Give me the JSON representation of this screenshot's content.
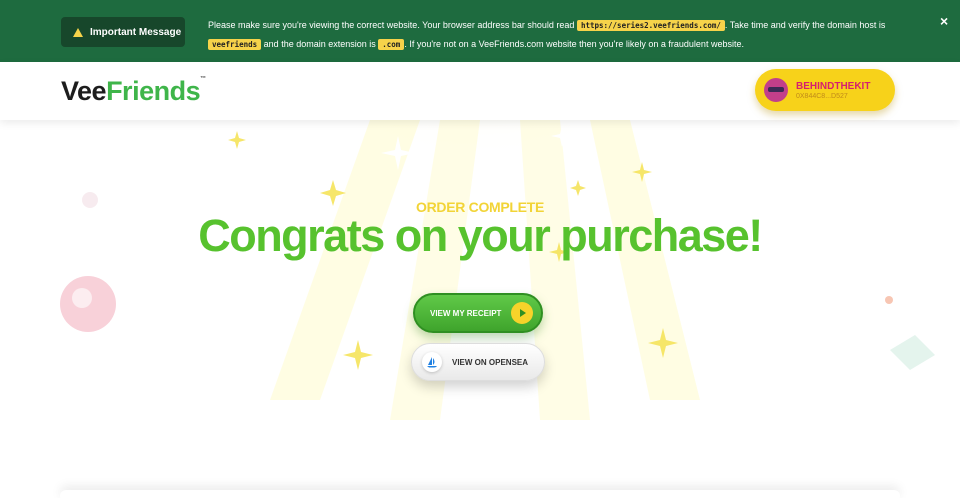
{
  "banner": {
    "important_label": "Important Message",
    "text_1": "Please make sure you're viewing the correct website. Your browser address bar should read",
    "url_code": "https://series2.veefriends.com/",
    "text_2": ". Take time and verify the domain host is",
    "host_code": "veefriends",
    "text_3": "and the domain extension is",
    "ext_code": ".com",
    "text_4": ". If you're not on a VeeFriends.com website then you're likely on a fraudulent website.",
    "close_label": "×"
  },
  "header": {
    "logo_vee": "Vee",
    "logo_friends": "Friends",
    "logo_tm": "™",
    "wallet_name": "BEHINDTHEKIT",
    "wallet_address": "0X844C8...D527"
  },
  "main": {
    "kicker": "ORDER COMPLETE",
    "headline": "Congrats on your purchase!",
    "receipt_label": "VIEW MY RECEIPT",
    "opensea_label": "VIEW ON OPENSEA"
  },
  "colors": {
    "banner_bg": "#1e6b3f",
    "accent_green": "#57c22e",
    "accent_yellow": "#f2d437",
    "wallet_pink": "#d6206e"
  },
  "icons": [
    "warning-icon",
    "close-icon",
    "avatar",
    "play-icon",
    "opensea-icon"
  ]
}
